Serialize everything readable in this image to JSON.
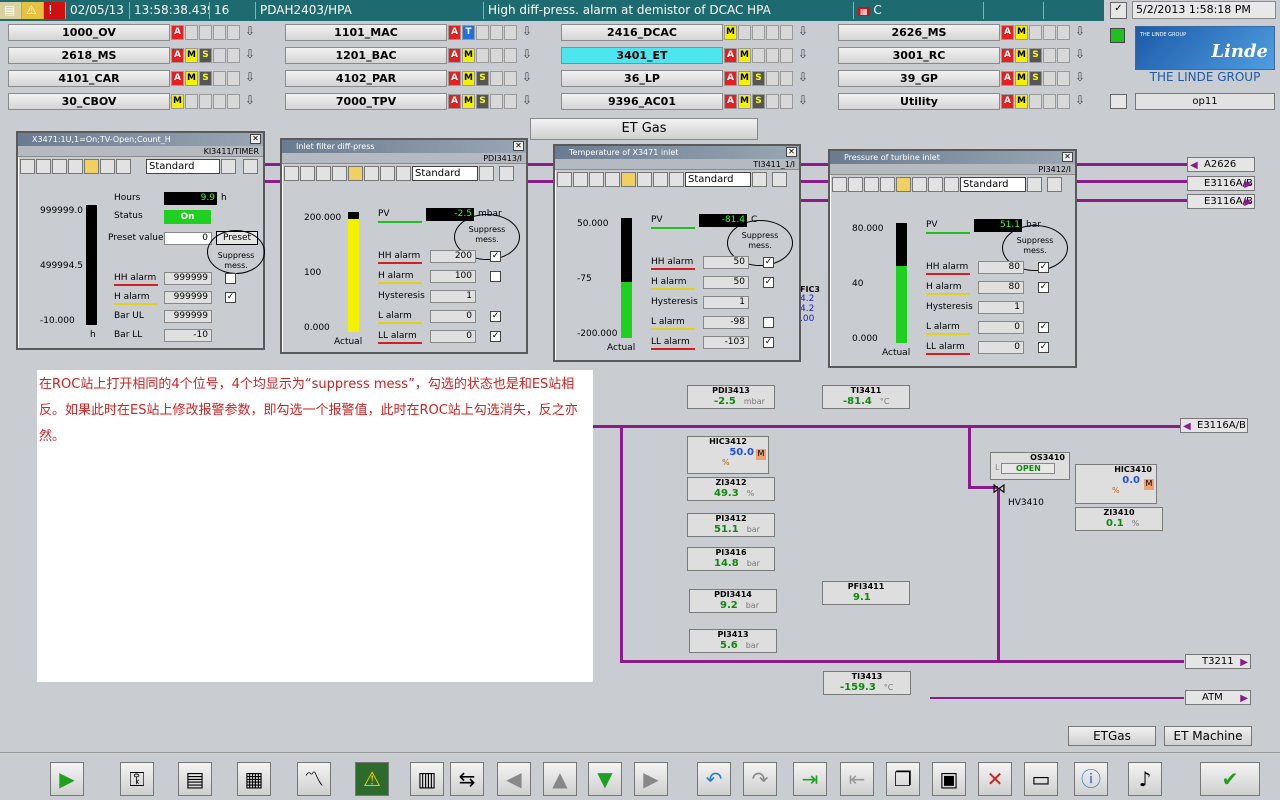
{
  "alarm_bar": {
    "date": "02/05/13",
    "time": "13:58:38.439",
    "priority": "16",
    "tag": "PDAH2403/HPA",
    "message": "High diff-press. alarm at demistor of DCAC HPA",
    "area": "C"
  },
  "clock": "5/2/2013 1:58:18 PM",
  "areas": [
    {
      "label": "1000_OV",
      "boxes": [
        "A"
      ]
    },
    {
      "label": "1101_MAC",
      "boxes": [
        "A",
        "T"
      ]
    },
    {
      "label": "2416_DCAC",
      "boxes": [
        "M"
      ]
    },
    {
      "label": "2626_MS",
      "boxes": [
        "A",
        "M"
      ]
    },
    {
      "label": "2618_MS",
      "boxes": [
        "A",
        "M",
        "S"
      ]
    },
    {
      "label": "1201_BAC",
      "boxes": [
        "A",
        "M"
      ]
    },
    {
      "label": "3401_ET",
      "boxes": [
        "A",
        "M"
      ]
    },
    {
      "label": "3001_RC",
      "boxes": [
        "A",
        "M",
        "S"
      ]
    },
    {
      "label": "4101_CAR",
      "boxes": [
        "A",
        "M",
        "S"
      ]
    },
    {
      "label": "4102_PAR",
      "boxes": [
        "A",
        "M",
        "S"
      ]
    },
    {
      "label": "36_LP",
      "boxes": [
        "A",
        "M",
        "S"
      ]
    },
    {
      "label": "39_GP",
      "boxes": [
        "A",
        "M",
        "S"
      ]
    },
    {
      "label": "30_CBOV",
      "boxes": [
        "M"
      ]
    },
    {
      "label": "7000_TPV",
      "boxes": [
        "A",
        "M",
        "S"
      ]
    },
    {
      "label": "9396_AC01",
      "boxes": [
        "A",
        "M",
        "S"
      ]
    },
    {
      "label": "Utility",
      "boxes": [
        "A",
        "M"
      ]
    }
  ],
  "logo": {
    "group": "THE LINDE GROUP",
    "brand": "Linde",
    "small": "THE LINDE GROUP"
  },
  "station": "op11",
  "screen_title": "ET Gas",
  "win1": {
    "title": "X3471:1U,1=On;TV-Open;Count_H",
    "tag": "KI3411/TIMER",
    "mode": "Standard",
    "hours_label": "Hours",
    "hours": "9.9",
    "hours_unit": "h",
    "status_label": "Status",
    "status": "On",
    "preset_label": "Preset value",
    "preset": "0",
    "preset_btn": "Preset",
    "scale_top": "999999.0",
    "scale_mid": "499994.5",
    "scale_bot": "-10.000",
    "unit": "h",
    "hh_label": "HH alarm",
    "hh": "999999",
    "h_label": "H alarm",
    "h": "999999",
    "ul_label": "Bar UL",
    "ul": "999999",
    "ll_label": "Bar LL",
    "ll": "-10",
    "suppress": "Suppress mess."
  },
  "win2": {
    "title": "Inlet filter diff-press",
    "tag": "PDI3413/I",
    "mode": "Standard",
    "pv_label": "PV",
    "pv": "-2.5",
    "unit": "mbar",
    "scale_top": "200.000",
    "scale_mid": "100",
    "scale_bot": "0.000",
    "actual": "Actual",
    "hh_label": "HH alarm",
    "hh": "200",
    "h_label": "H alarm",
    "h": "100",
    "hyst_label": "Hysteresis",
    "hyst": "1",
    "l_label": "L alarm",
    "l": "0",
    "ll_label": "LL alarm",
    "ll": "0",
    "suppress": "Suppress mess."
  },
  "win3": {
    "title": "Temperature of X3471 inlet",
    "tag": "TI3411_1/I",
    "mode": "Standard",
    "pv_label": "PV",
    "pv": "-81.4",
    "unit": "C",
    "scale_top": "50.000",
    "scale_mid": "-75",
    "scale_bot": "-200.000",
    "actual": "Actual",
    "hh_label": "HH alarm",
    "hh": "50",
    "h_label": "H alarm",
    "h": "50",
    "hyst_label": "Hysteresis",
    "hyst": "1",
    "l_label": "L alarm",
    "l": "-98",
    "ll_label": "LL alarm",
    "ll": "-103",
    "suppress": "Suppress mess."
  },
  "win4": {
    "title": "Pressure of turbine inlet",
    "tag": "PI3412/I",
    "mode": "Standard",
    "pv_label": "PV",
    "pv": "51.1",
    "unit": "bar",
    "scale_top": "80.000",
    "scale_mid": "40",
    "scale_bot": "0.000",
    "actual": "Actual",
    "hh_label": "HH alarm",
    "hh": "80",
    "h_label": "H alarm",
    "h": "80",
    "hyst_label": "Hysteresis",
    "hyst": "1",
    "l_label": "L alarm",
    "l": "0",
    "ll_label": "LL alarm",
    "ll": "0",
    "suppress": "Suppress mess."
  },
  "note": "在ROC站上打开相同的4个位号，4个均显示为“suppress mess”，勾选的状态也是和ES站相反。如果此时在ES站上修改报警参数，即勾选一个报警值，此时在ROC站上勾选消失，反之亦然。",
  "dest": {
    "a2626": "A2626",
    "e3116a": "E3116A/B",
    "e3116b": "E3116A/B",
    "e3116c": "E3116A/B",
    "t3211": "T3211",
    "atm": "ATM"
  },
  "fic": {
    "name": "FIC3",
    "v1": "4.2",
    "v2": "4.2",
    "v3": ".00"
  },
  "faceplates": {
    "pdi3413": {
      "name": "PDI3413",
      "value": "-2.5",
      "unit": "mbar"
    },
    "ti3411": {
      "name": "TI3411",
      "value": "-81.4",
      "unit": "°C"
    },
    "hic3412": {
      "name": "HIC3412",
      "value": "50.0",
      "unit": "%",
      "mode": "M",
      "l": "L"
    },
    "zi3412": {
      "name": "ZI3412",
      "value": "49.3",
      "unit": "%"
    },
    "pi3412": {
      "name": "PI3412",
      "value": "51.1",
      "unit": "bar"
    },
    "pi3416": {
      "name": "PI3416",
      "value": "14.8",
      "unit": "bar"
    },
    "pdi3414": {
      "name": "PDI3414",
      "value": "9.2",
      "unit": "bar"
    },
    "pi3413": {
      "name": "PI3413",
      "value": "5.6",
      "unit": "bar"
    },
    "pfi3411": {
      "name": "PFI3411",
      "value": "9.1"
    },
    "ti3413": {
      "name": "TI3413",
      "value": "-159.3",
      "unit": "°C"
    },
    "os3410": {
      "name": "OS3410",
      "l": "L",
      "state": "OPEN"
    },
    "hic3410": {
      "name": "HIC3410",
      "value": "0.0",
      "unit": "%",
      "mode": "M",
      "l": "L"
    },
    "zi3410": {
      "name": "ZI3410",
      "value": "0.1",
      "unit": "%"
    }
  },
  "valve": "HV3410",
  "nav": {
    "etgas": "ETGas",
    "etmachine": "ET Machine"
  }
}
